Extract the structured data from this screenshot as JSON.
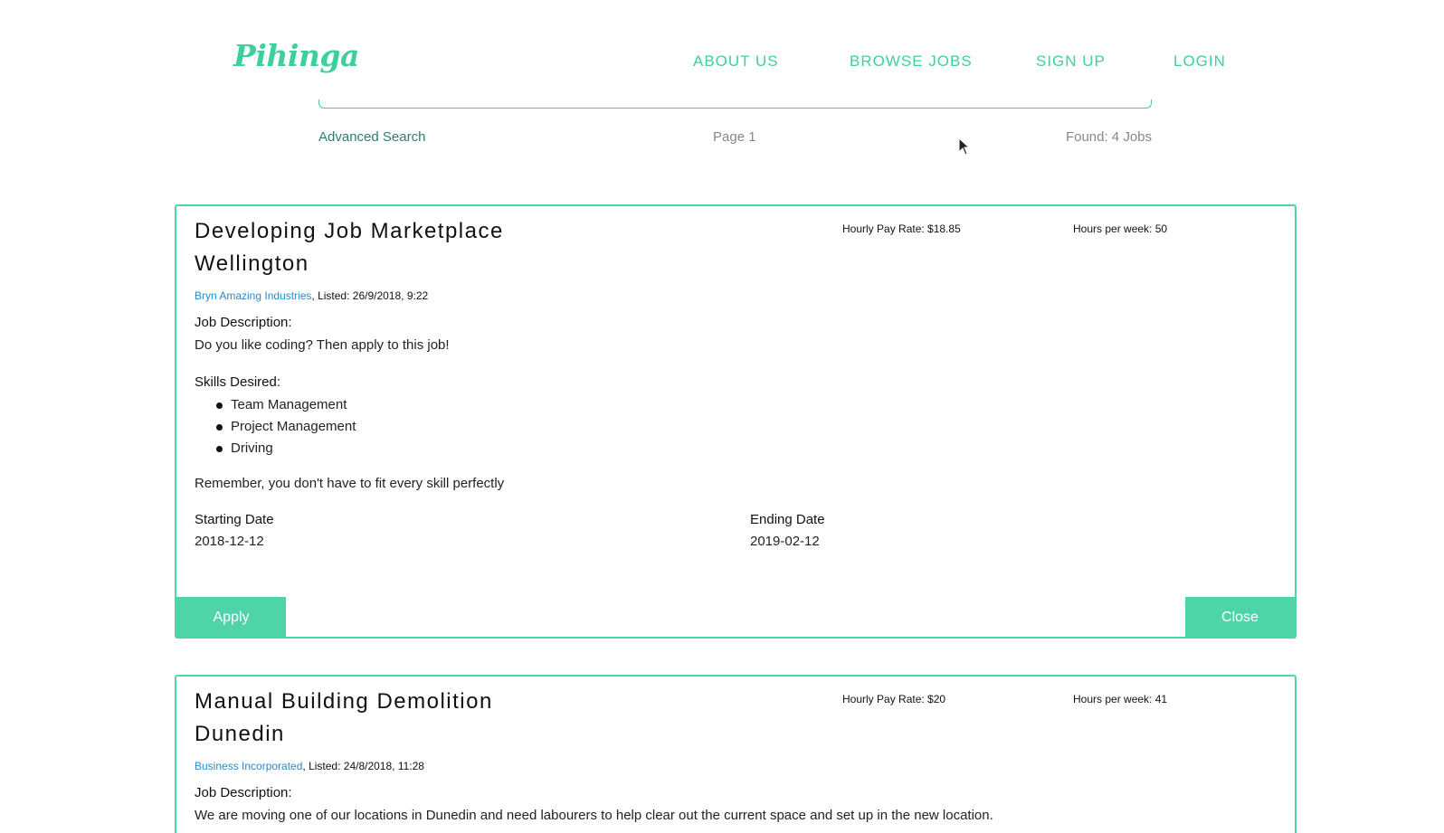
{
  "header": {
    "logo": "Pihinga",
    "nav": [
      "ABOUT US",
      "BROWSE JOBS",
      "SIGN UP",
      "LOGIN"
    ]
  },
  "search": {
    "advanced_label": "Advanced Search",
    "page_label": "Page 1",
    "found_label": "Found: 4 Jobs"
  },
  "jobs": [
    {
      "title_line1": "Developing Job Marketplace",
      "title_line2": "Wellington",
      "pay": "Hourly Pay Rate: $18.85",
      "hours": "Hours per week: 50",
      "company": "Bryn Amazing Industries",
      "listed": ", Listed: 26/9/2018, 9:22",
      "description_label": "Job Description:",
      "description": "Do you like coding? Then apply to this job!",
      "skills_label": "Skills Desired:",
      "skills": [
        "Team Management",
        "Project Management",
        "Driving"
      ],
      "reminder": "Remember, you don't have to fit every skill perfectly",
      "start_label": "Starting Date",
      "start_date": "2018-12-12",
      "end_label": "Ending Date",
      "end_date": "2019-02-12",
      "apply_label": "Apply",
      "close_label": "Close"
    },
    {
      "title_line1": "Manual Building Demolition",
      "title_line2": "Dunedin",
      "pay": "Hourly Pay Rate: $20",
      "hours": "Hours per week: 41",
      "company": "Business Incorporated",
      "listed": ", Listed: 24/8/2018, 11:28",
      "description_label": "Job Description:",
      "description": "We are moving one of our locations in Dunedin and need labourers to help clear out the current space and set up in the new location."
    }
  ]
}
